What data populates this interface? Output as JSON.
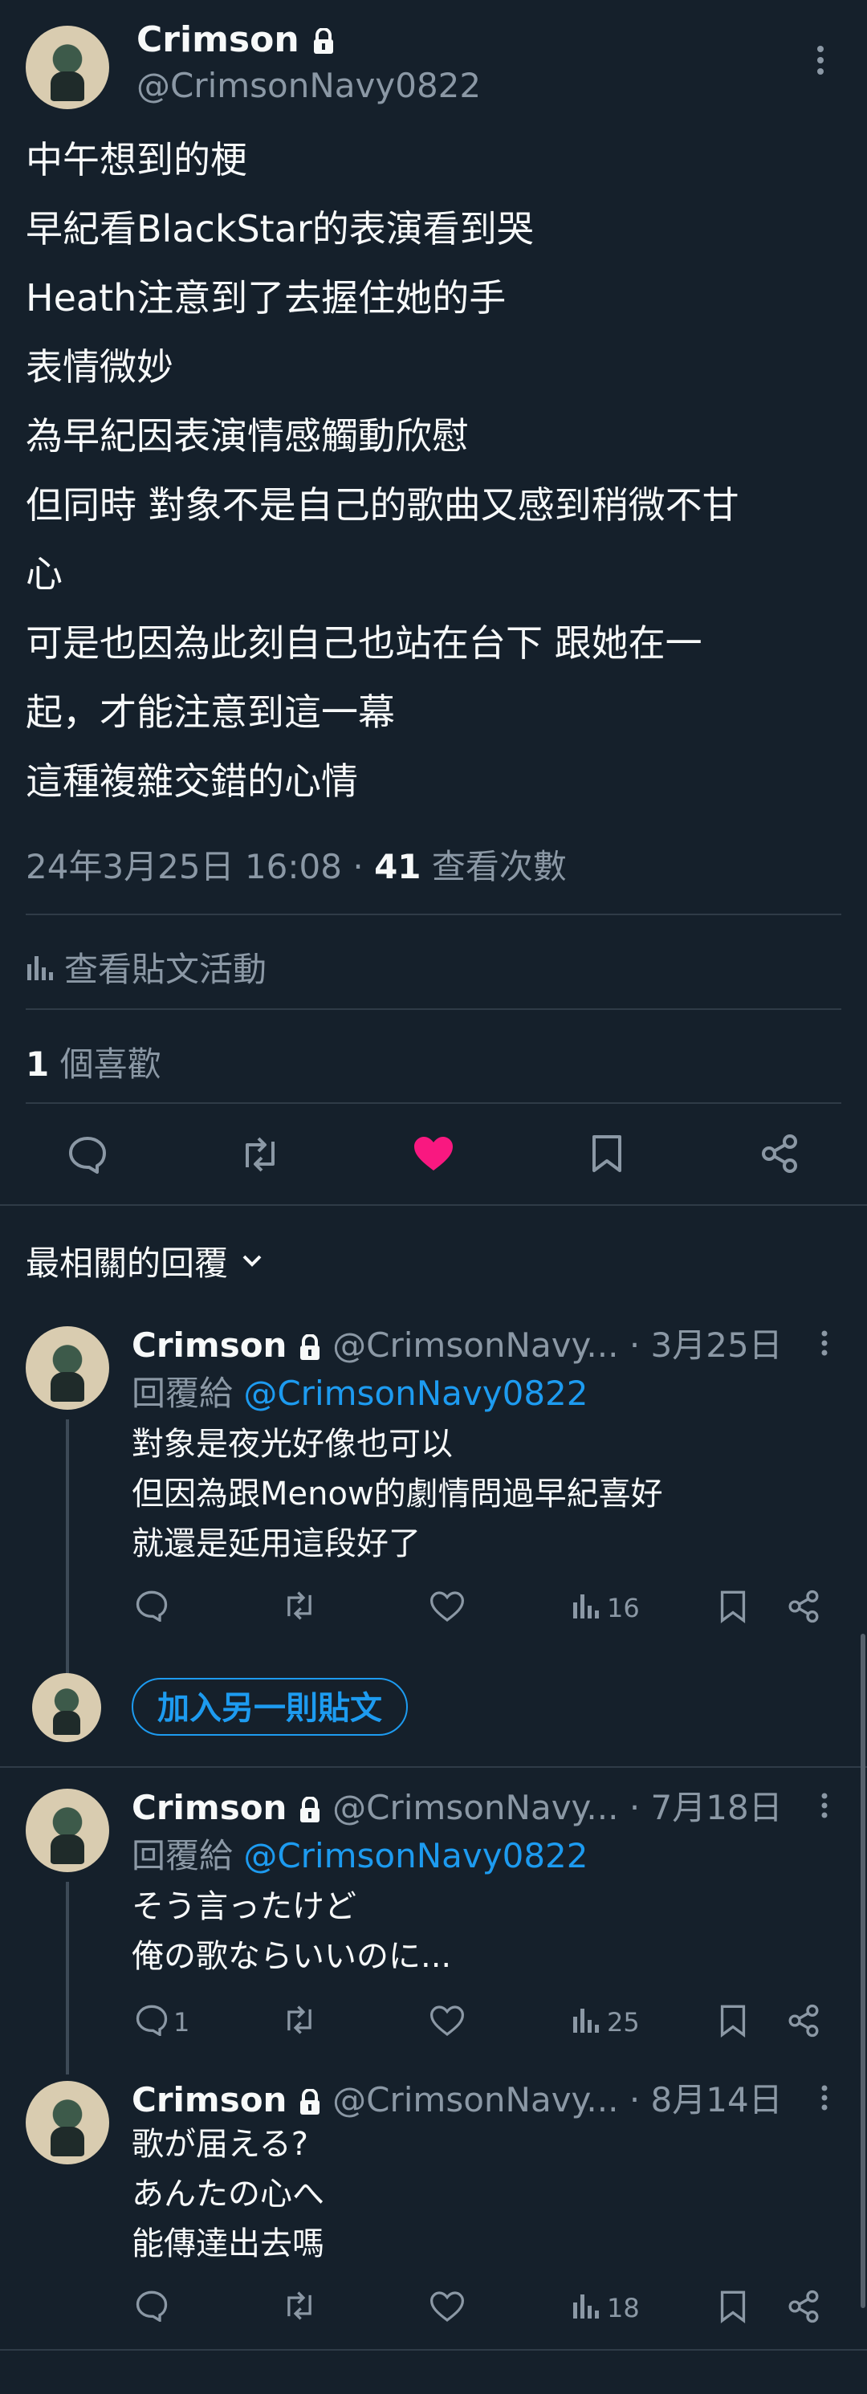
{
  "post": {
    "author_name": "Crimson",
    "author_handle": "@CrimsonNavy0822",
    "lines": [
      "中午想到的梗",
      "早紀看BlackStar的表演看到哭",
      "Heath注意到了去握住她的手",
      "表情微妙",
      "為早紀因表演情感觸動欣慰",
      "但同時 對象不是自己的歌曲又感到稍微不甘",
      "心",
      "可是也因為此刻自己也站在台下 跟她在一",
      "起，才能注意到這一幕",
      "這種複雜交錯的心情"
    ],
    "timestamp": "24年3月25日 16:08 · ",
    "views_count": "41",
    "views_label": " 查看次數",
    "activity_label": "查看貼文活動",
    "likes_count": "1",
    "likes_label": " 個喜歡"
  },
  "replies_header": "最相關的回覆",
  "replies": [
    {
      "name": "Crimson",
      "handle": "@CrimsonNavy...",
      "date": "· 3月25日",
      "reply_to_label": "回覆給 ",
      "reply_to": "@CrimsonNavy0822",
      "lines": [
        "對象是夜光好像也可以",
        "但因為跟Menow的劇情問過早紀喜好",
        "就還是延用這段好了"
      ],
      "comments": "",
      "views": "16"
    },
    {
      "name": "Crimson",
      "handle": "@CrimsonNavy...",
      "date": "· 7月18日",
      "reply_to_label": "回覆給 ",
      "reply_to": "@CrimsonNavy0822",
      "lines": [
        "そう言ったけど",
        "俺の歌ならいいのに..."
      ],
      "comments": "1",
      "views": "25"
    },
    {
      "name": "Crimson",
      "handle": "@CrimsonNavy...",
      "date": "· 8月14日",
      "lines": [
        "歌が届える?",
        "あんたの心へ",
        "能傳達出去嗎"
      ],
      "comments": "",
      "views": "18"
    }
  ],
  "add_post_label": "加入另一則貼文",
  "colors": {
    "background": "#15202b",
    "accent": "#1d9bf0",
    "like": "#f91880",
    "muted": "#8b98a5"
  }
}
